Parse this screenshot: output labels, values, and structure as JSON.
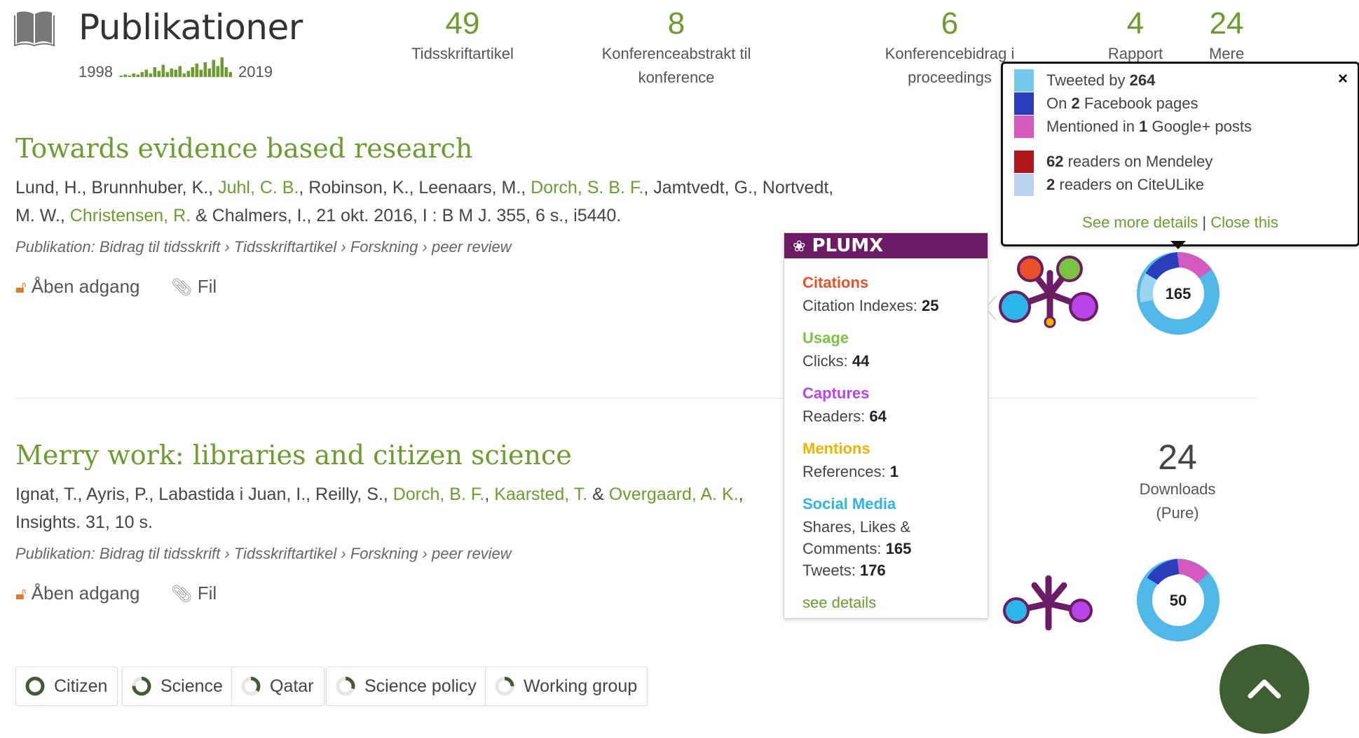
{
  "header": {
    "title": "Publikationer",
    "year_start": "1998",
    "year_end": "2019",
    "stats": [
      {
        "count": "49",
        "label_lines": [
          "Tidsskriftartikel",
          ""
        ]
      },
      {
        "count": "8",
        "label_lines": [
          "Konferenceabstrakt til",
          "konference"
        ]
      },
      {
        "count": "6",
        "label_lines": [
          "Konferencebidrag i",
          "proceedings"
        ]
      },
      {
        "count": "4",
        "label_lines": [
          "Rapport",
          ""
        ]
      },
      {
        "count": "24",
        "label_lines": [
          "Mere",
          ""
        ]
      }
    ],
    "sparkline_values": [
      1,
      2,
      1,
      3,
      2,
      4,
      6,
      3,
      8,
      5,
      10,
      4,
      7,
      6,
      9,
      3,
      5,
      8,
      11,
      6,
      12,
      7,
      14,
      9,
      16,
      8,
      4
    ]
  },
  "results": [
    {
      "title": "Towards evidence based research",
      "authors_line1": [
        {
          "text": "Lund, H., Brunnhuber, K., ",
          "link": false
        },
        {
          "text": "Juhl, C. B.",
          "link": true
        },
        {
          "text": ", Robinson, K., Leenaars, M., ",
          "link": false
        },
        {
          "text": "Dorch, S. B. F.",
          "link": true
        },
        {
          "text": ", Jamtvedt, G., Nortvedt,",
          "link": false
        }
      ],
      "authors_line2": [
        {
          "text": "M. W., ",
          "link": false
        },
        {
          "text": "Christensen, R.",
          "link": true
        },
        {
          "text": " & Chalmers, I., 21 okt. 2016, I : B M J. 355, 6 s., i5440.",
          "link": false
        }
      ],
      "publication": "Publikation: Bidrag til tidsskrift › Tidsskriftartikel › Forskning › peer review",
      "open_access": "Åben adgang",
      "file": "Fil",
      "altmetric_score": "165"
    },
    {
      "title": "Merry work: libraries and citizen science",
      "authors_line1": [
        {
          "text": "Ignat, T., Ayris, P., Labastida i Juan, I., Reilly, S., ",
          "link": false
        },
        {
          "text": "Dorch, B. F.",
          "link": true
        },
        {
          "text": ", ",
          "link": false
        },
        {
          "text": "Kaarsted, T.",
          "link": true
        },
        {
          "text": " & ",
          "link": false
        },
        {
          "text": "Overgaard, A. K.",
          "link": true
        },
        {
          "text": ",",
          "link": false
        }
      ],
      "authors_line2": [
        {
          "text": "Insights. 31, 10 s.",
          "link": false
        }
      ],
      "publication": "Publikation: Bidrag til tidsskrift › Tidsskriftartikel › Forskning › peer review",
      "open_access": "Åben adgang",
      "file": "Fil",
      "altmetric_score": "50",
      "downloads_count": "24",
      "downloads_label": "Downloads",
      "downloads_source": "(Pure)"
    }
  ],
  "plumx": {
    "brand": "PLUMX",
    "groups": [
      {
        "name": "Citations",
        "color": "#e8512a",
        "metrics": [
          {
            "label": "Citation Indexes: ",
            "value": "25"
          }
        ]
      },
      {
        "name": "Usage",
        "color": "#7bc142",
        "metrics": [
          {
            "label": "Clicks: ",
            "value": "44"
          }
        ]
      },
      {
        "name": "Captures",
        "color": "#b845e8",
        "metrics": [
          {
            "label": "Readers: ",
            "value": "64"
          }
        ]
      },
      {
        "name": "Mentions",
        "color": "#f0b400",
        "metrics": [
          {
            "label": "References: ",
            "value": "1"
          }
        ]
      },
      {
        "name": "Social Media",
        "color": "#2cb5e8",
        "metrics": [
          {
            "label": "Shares, Likes &",
            "value": ""
          },
          {
            "label": "Comments: ",
            "value": "165"
          },
          {
            "label": "Tweets: ",
            "value": "176"
          }
        ]
      }
    ],
    "see_details": "see details"
  },
  "altmetric_tooltip": {
    "rows": [
      {
        "color": "#74c8ec",
        "pre": "Tweeted by ",
        "bold": "264",
        "post": ""
      },
      {
        "color": "#2a3dbd",
        "pre": "On ",
        "bold": "2",
        "post": " Facebook pages"
      },
      {
        "color": "#d45ac0",
        "pre": "Mentioned in ",
        "bold": "1",
        "post": " Google+ posts"
      },
      {
        "color": "#b0151b",
        "pre": "",
        "bold": "62",
        "post": " readers on Mendeley"
      },
      {
        "color": "#b9d3ef",
        "pre": "",
        "bold": "2",
        "post": " readers on CiteULike"
      }
    ],
    "see_more": "See more details",
    "separator": " | ",
    "close_link": "Close this",
    "close_symbol": "×"
  },
  "keywords": [
    {
      "label": "Citizen",
      "fill": 1.0
    },
    {
      "label": "Science",
      "fill": 0.75
    },
    {
      "label": "Qatar",
      "fill": 0.35
    },
    {
      "label": "Science policy",
      "fill": 0.3
    },
    {
      "label": "Working group",
      "fill": 0.25
    }
  ],
  "icons": {
    "book": "book-icon",
    "open_access": "unlocked-icon",
    "file": "paperclip-icon",
    "scroll_top": "chevron-up-icon"
  },
  "colors": {
    "accent_green": "#6a9d2e",
    "plumx_purple": "#6b1c65",
    "scroll_button": "#3f5f32"
  }
}
